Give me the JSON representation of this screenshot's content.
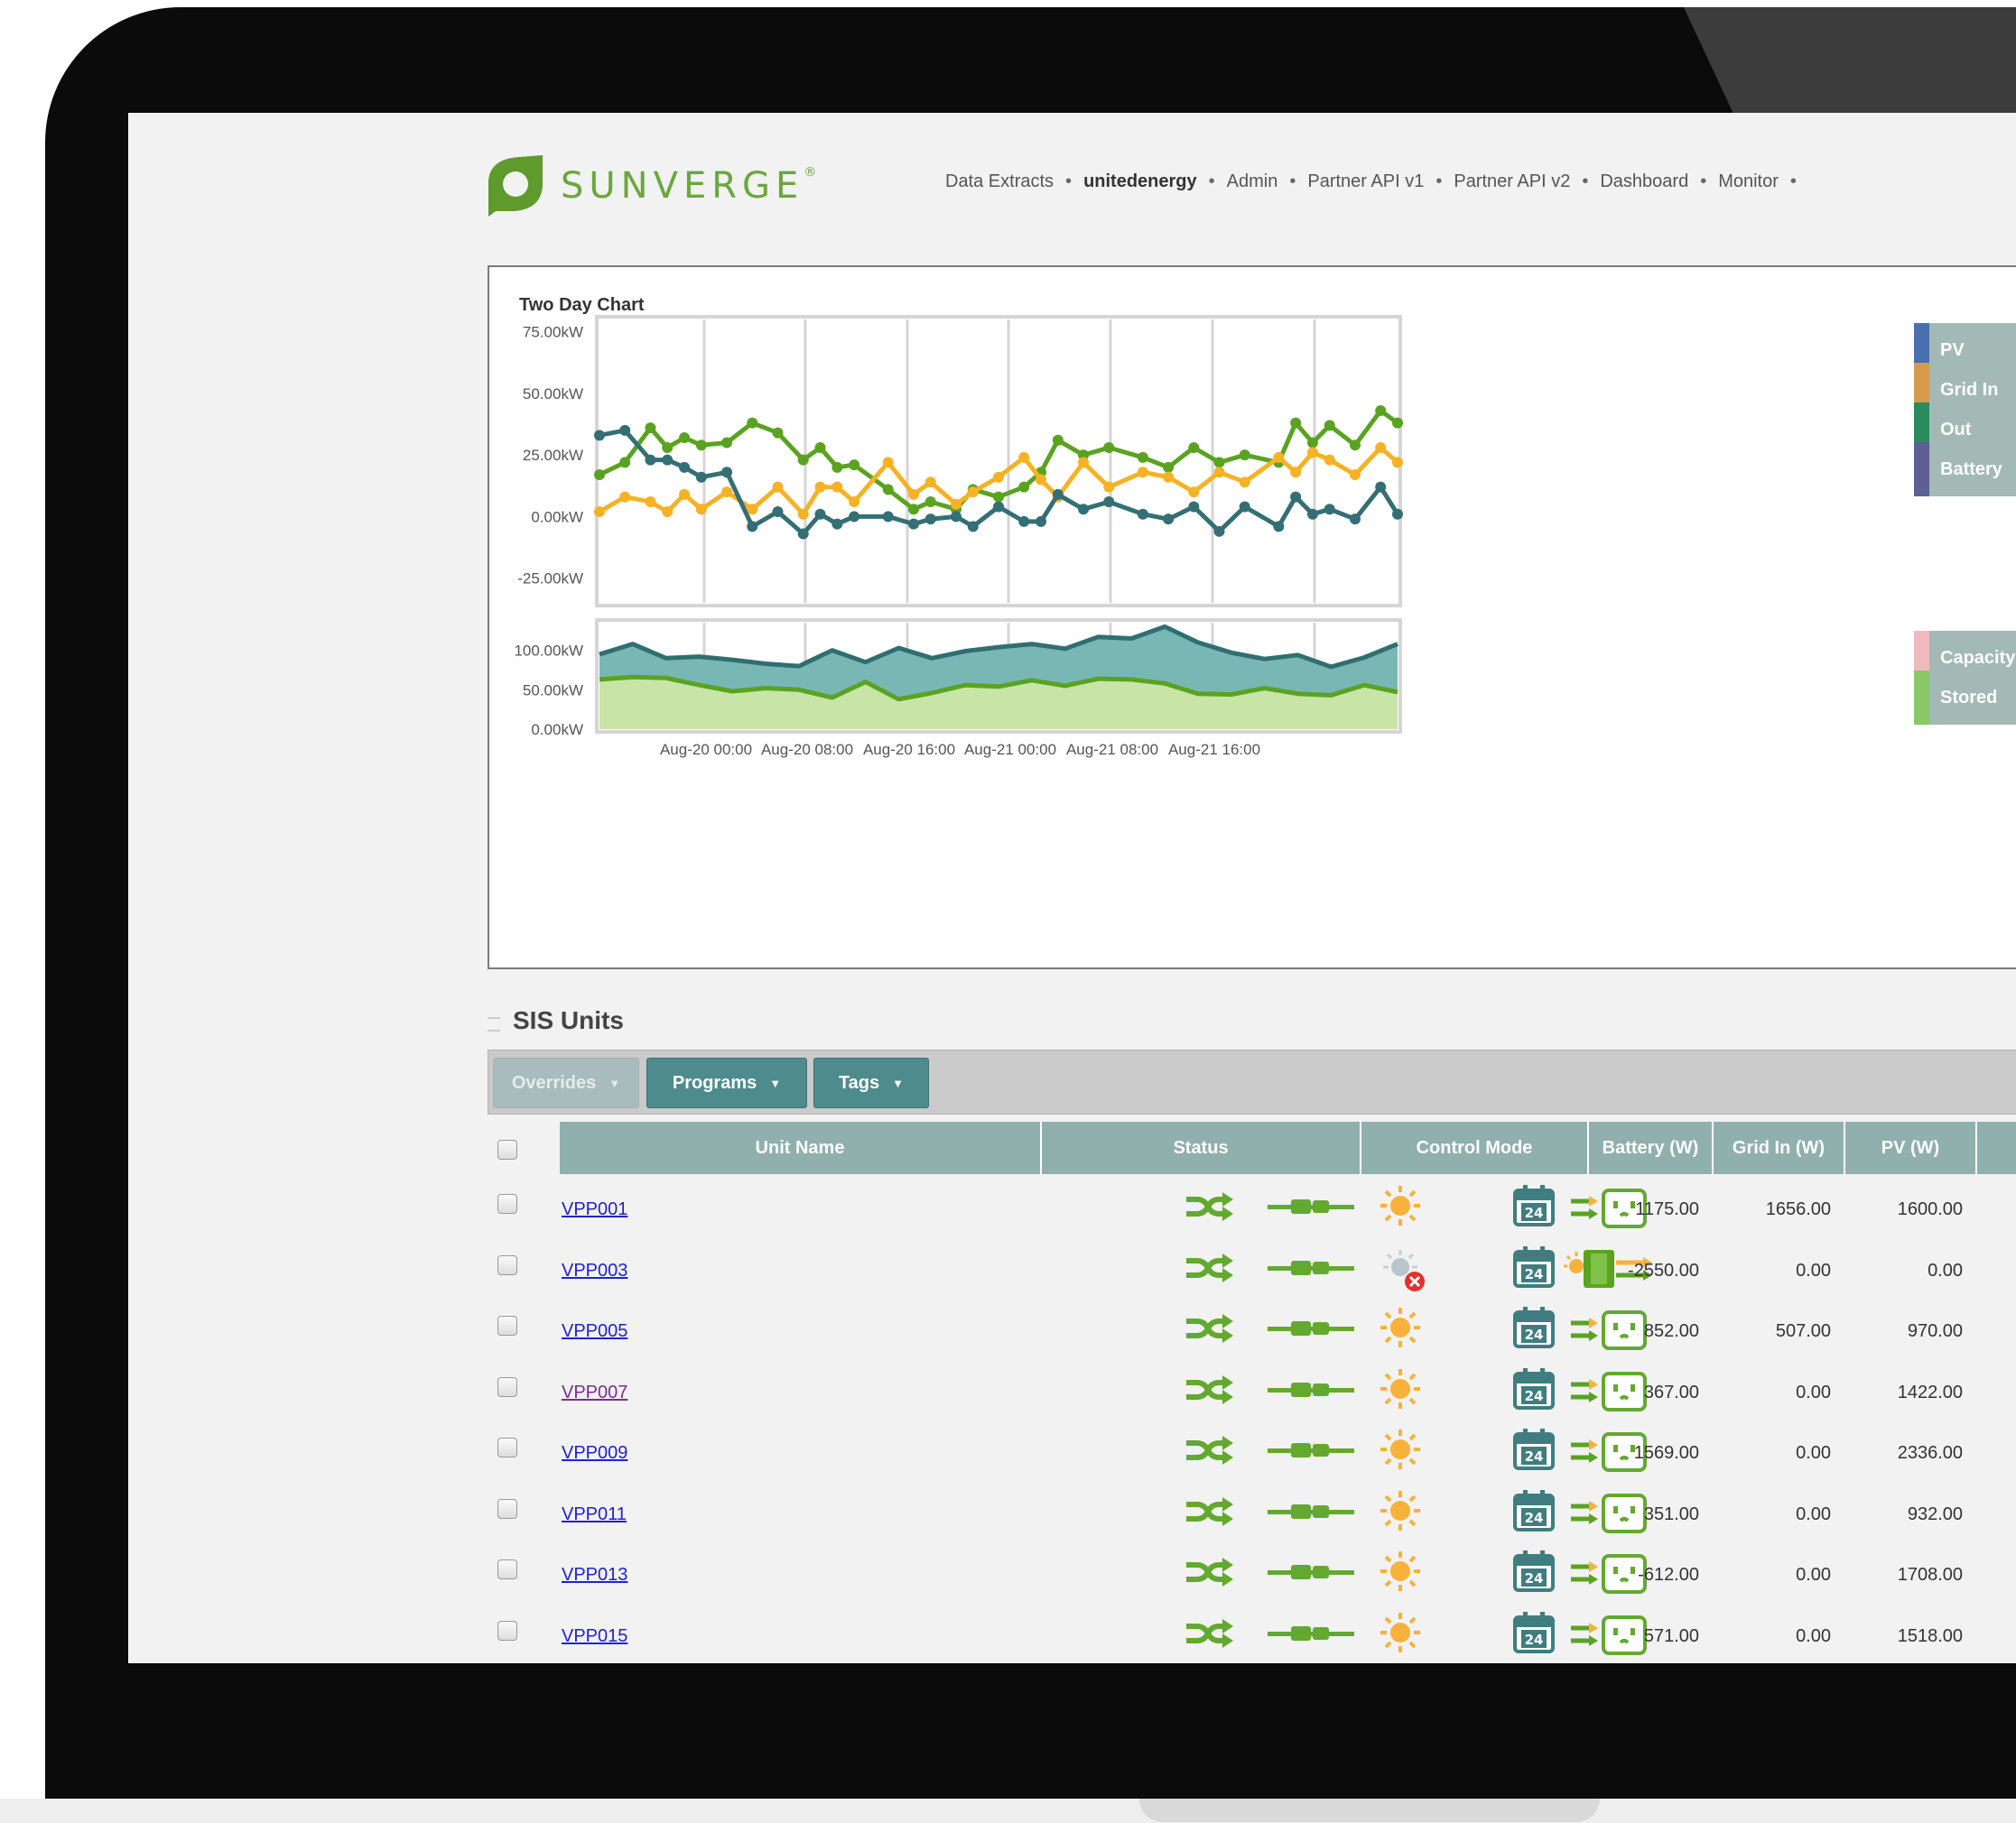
{
  "brand": {
    "name": "SUNVERGE",
    "mark": "®"
  },
  "nav": [
    "Data Extracts",
    "unitedenergy",
    "Admin",
    "Partner API v1",
    "Partner API v2",
    "Dashboard",
    "Monitor"
  ],
  "chart_panel": {
    "title": "Two Day Chart",
    "legend_top": [
      {
        "label": "PV",
        "color": "#4a6fae"
      },
      {
        "label": "Grid In",
        "color": "#d79a4c"
      },
      {
        "label": "Out",
        "color": "#2a8c5c"
      },
      {
        "label": "Battery",
        "color": "#5e5f92"
      }
    ],
    "legend_bottom": [
      {
        "label": "Capacity",
        "color": "#f0b9bd"
      },
      {
        "label": "Stored",
        "color": "#89c767"
      }
    ]
  },
  "chart_data": [
    {
      "type": "line",
      "title": "Two Day Chart",
      "yticks": [
        "75.00kW",
        "50.00kW",
        "25.00kW",
        "0.00kW",
        "-25.00kW"
      ],
      "ylim": [
        -35,
        80
      ],
      "colors": {
        "green": "#5aa321",
        "orange": "#f6b225",
        "teal": "#336f75"
      },
      "x_hours": [
        0,
        1.5,
        3,
        4,
        5,
        6,
        7.5,
        9,
        10.5,
        12,
        13,
        14,
        15,
        17,
        18.5,
        19.5,
        21,
        22,
        23.5,
        25,
        26,
        27,
        28.5,
        30,
        32,
        33.5,
        35,
        36.5,
        38,
        40,
        41,
        42,
        43,
        44.5,
        46,
        47
      ],
      "series": [
        {
          "color": "green",
          "values": [
            17,
            22,
            36,
            28,
            32,
            29,
            30,
            38,
            34,
            23,
            28,
            20,
            21,
            11,
            3,
            6,
            3,
            11,
            8,
            12,
            18,
            31,
            25,
            28,
            24,
            20,
            28,
            22,
            25,
            22,
            38,
            30,
            37,
            29,
            43,
            38
          ]
        },
        {
          "color": "orange",
          "values": [
            2,
            8,
            6,
            2,
            9,
            3,
            10,
            3,
            12,
            1,
            12,
            12,
            6,
            22,
            9,
            14,
            5,
            10,
            16,
            24,
            15,
            8,
            22,
            12,
            18,
            16,
            10,
            18,
            14,
            24,
            18,
            26,
            23,
            17,
            28,
            22
          ]
        },
        {
          "color": "teal",
          "values": [
            33,
            35,
            23,
            23,
            20,
            16,
            18,
            -4,
            2,
            -7,
            1,
            -3,
            0,
            0,
            -3,
            -1,
            0,
            -4,
            4,
            -2,
            -2,
            9,
            3,
            6,
            1,
            -1,
            4,
            -6,
            4,
            -4,
            8,
            1,
            3,
            -1,
            12,
            1
          ]
        }
      ]
    },
    {
      "type": "area",
      "yticks": [
        "100.00kW",
        "50.00kW",
        "0.00kW"
      ],
      "xticks": [
        "Aug-20 00:00",
        "Aug-20 08:00",
        "Aug-20 16:00",
        "Aug-21 00:00",
        "Aug-21 08:00",
        "Aug-21 16:00"
      ],
      "ylim": [
        0,
        135
      ],
      "x_hours": [
        0,
        2,
        4,
        6,
        8,
        10,
        12,
        14,
        16,
        18,
        20,
        22,
        24,
        26,
        28,
        30,
        32,
        34,
        36,
        38,
        40,
        42,
        44,
        46,
        48
      ],
      "series": [
        {
          "name": "Capacity",
          "color": "#2f6f72",
          "fill": "#79b7b4",
          "values": [
            95,
            108,
            90,
            92,
            88,
            83,
            80,
            100,
            85,
            103,
            90,
            99,
            104,
            108,
            102,
            117,
            115,
            130,
            110,
            97,
            89,
            94,
            79,
            91,
            108
          ]
        },
        {
          "name": "Stored",
          "color": "#5aa321",
          "fill": "#c8e4a7",
          "values": [
            63,
            66,
            65,
            56,
            48,
            52,
            50,
            40,
            60,
            38,
            46,
            56,
            54,
            62,
            55,
            64,
            63,
            58,
            45,
            44,
            52,
            45,
            43,
            56,
            47
          ]
        }
      ]
    }
  ],
  "sis": {
    "title": "SIS Units",
    "buttons": {
      "overrides": "Overrides",
      "programs": "Programs",
      "tags": "Tags"
    },
    "columns": {
      "unit_name": "Unit Name",
      "status": "Status",
      "control_mode": "Control Mode",
      "battery": "Battery (W)",
      "grid_in": "Grid In (W)",
      "pv": "PV (W)"
    },
    "rows": [
      {
        "name": "VPP001",
        "battery": "1175.00",
        "grid_in": "1656.00",
        "pv": "1600.00",
        "visited": false,
        "sun_off": false
      },
      {
        "name": "VPP003",
        "battery": "-2550.00",
        "grid_in": "0.00",
        "pv": "0.00",
        "visited": false,
        "sun_off": true
      },
      {
        "name": "VPP005",
        "battery": "852.00",
        "grid_in": "507.00",
        "pv": "970.00",
        "visited": false,
        "sun_off": false
      },
      {
        "name": "VPP007",
        "battery": "367.00",
        "grid_in": "0.00",
        "pv": "1422.00",
        "visited": true,
        "sun_off": false
      },
      {
        "name": "VPP009",
        "battery": "1569.00",
        "grid_in": "0.00",
        "pv": "2336.00",
        "visited": false,
        "sun_off": false
      },
      {
        "name": "VPP011",
        "battery": "351.00",
        "grid_in": "0.00",
        "pv": "932.00",
        "visited": false,
        "sun_off": false
      },
      {
        "name": "VPP013",
        "battery": "-612.00",
        "grid_in": "0.00",
        "pv": "1708.00",
        "visited": false,
        "sun_off": false
      },
      {
        "name": "VPP015",
        "battery": "571.00",
        "grid_in": "0.00",
        "pv": "1518.00",
        "visited": false,
        "sun_off": false
      }
    ],
    "calendar_day": "24"
  }
}
